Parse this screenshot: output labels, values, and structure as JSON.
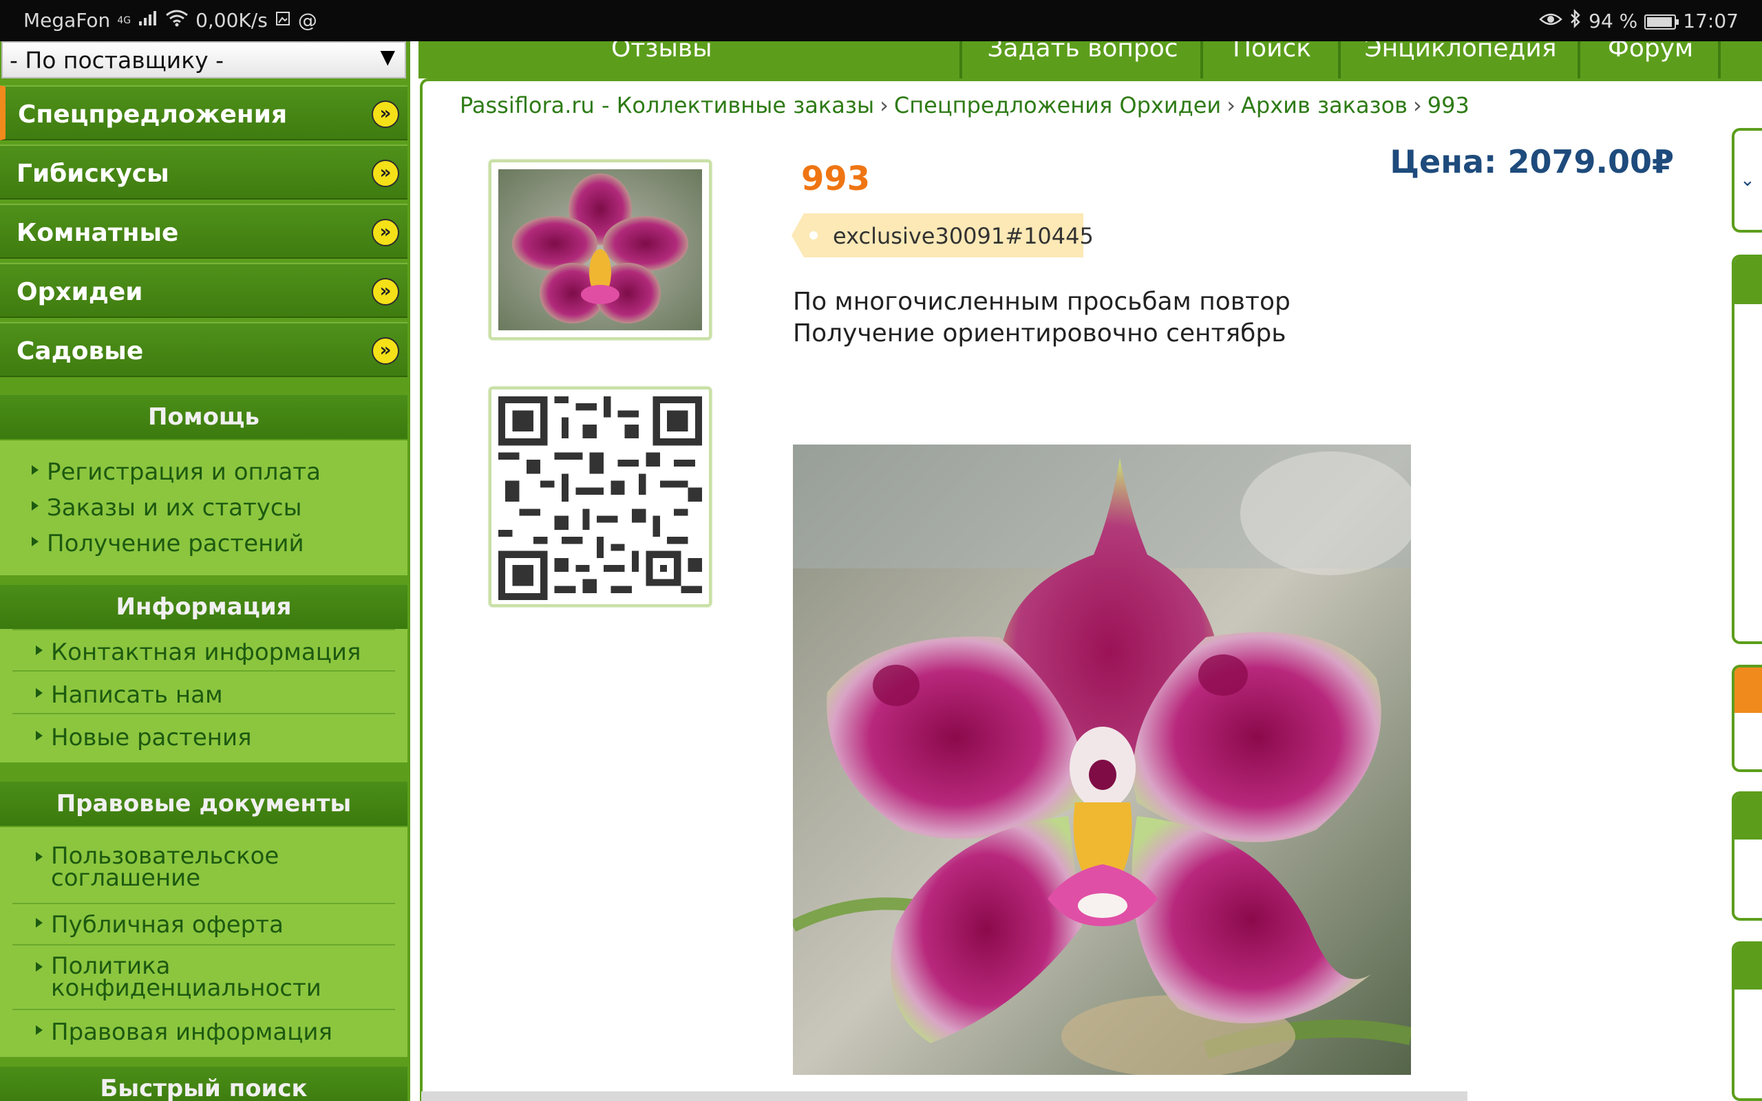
{
  "statusbar": {
    "carrier": "MegaFon",
    "network": "4G",
    "speed": "0,00K/s",
    "battery": "94 %",
    "time": "17:07"
  },
  "sidebar": {
    "supplier_select": "- По поставщику -",
    "categories": [
      {
        "label": "Спецпредложения"
      },
      {
        "label": "Гибискусы"
      },
      {
        "label": "Комнатные"
      },
      {
        "label": "Орхидеи"
      },
      {
        "label": "Садовые"
      }
    ],
    "help": {
      "title": "Помощь",
      "links": [
        "Регистрация и оплата",
        "Заказы и их статусы",
        "Получение растений"
      ]
    },
    "info": {
      "title": "Информация",
      "links": [
        "Контактная информация",
        "Написать нам",
        "Новые растения"
      ]
    },
    "legal": {
      "title": "Правовые документы",
      "links": [
        "Пользовательское соглашение",
        "Публичная оферта",
        "Политика конфиденциальности",
        "Правовая информация"
      ]
    },
    "quick_search": {
      "title": "Быстрый поиск"
    }
  },
  "topnav": [
    "Отзывы",
    "Задать вопрос",
    "Поиск",
    "Энциклопедия",
    "Форум"
  ],
  "breadcrumb": [
    "Passiflora.ru - Коллективные заказы",
    "Спецпредложения Орхидеи",
    "Архив заказов",
    "993"
  ],
  "breadcrumb_separator": "›",
  "product": {
    "title": "993",
    "price": "Цена: 2079.00₽",
    "tag": "exclusive30091#10445",
    "description": [
      "По многочисленным просьбам повтор",
      "Получение ориентировочно сентябрь"
    ]
  },
  "colors": {
    "brand_green": "#5c9e1c",
    "accent_orange": "#ef7512",
    "price_blue": "#1e4b7c",
    "link_green": "#2e7b16",
    "icon_yellow": "#f4e117"
  }
}
